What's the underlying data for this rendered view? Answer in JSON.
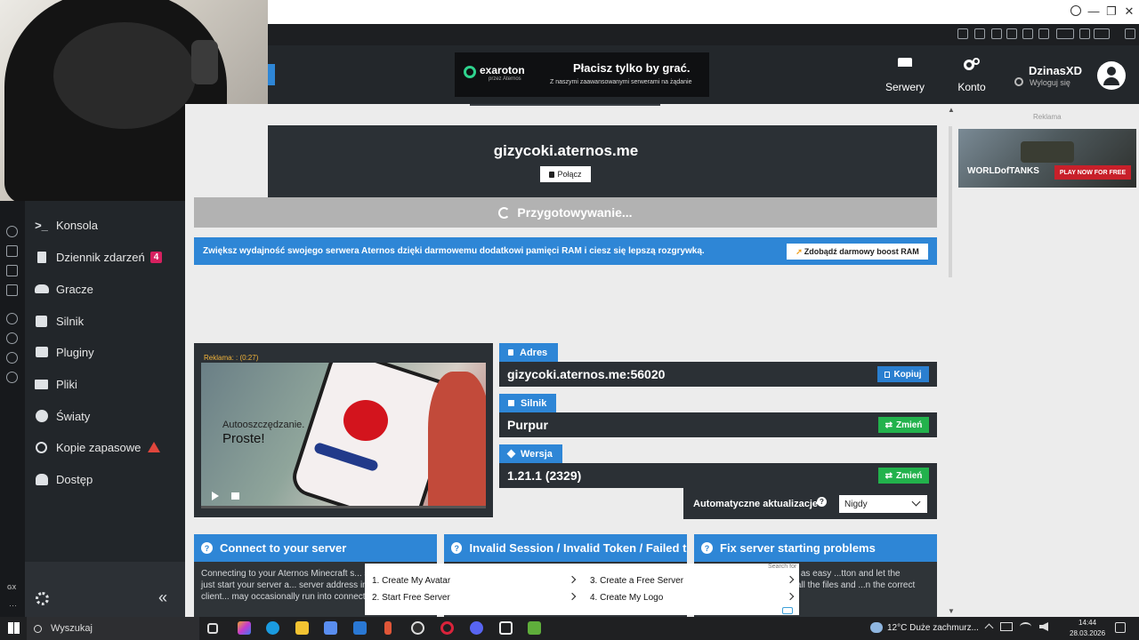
{
  "window": {
    "minimize": "—",
    "maximize": "❐",
    "close": "✕"
  },
  "header": {
    "ad_brand": "exaroton",
    "ad_brand_sub": "przez Aternos",
    "ad_title": "Płacisz tylko by grać.",
    "ad_subtitle": "Z naszymi zaawansowanymi serwerami na żądanie",
    "servers_label": "Serwery",
    "account_label": "Konto",
    "username": "DzinasXD",
    "logout": "Wyloguj się"
  },
  "server": {
    "hostname": "gizycoki.aternos.me",
    "connect_label": "Połącz",
    "status": "Przygotowywanie..."
  },
  "promo": {
    "text": "Zwiększ wydajność swojego serwera Aternos dzięki darmowemu dodatkowi pamięci RAM i ciesz się lepszą rozgrywką.",
    "button": "Zdobądź darmowy boost RAM"
  },
  "video_ad": {
    "timer": "Reklama: : (0:27)",
    "caption_line1": "Autooszczędzanie.",
    "caption_line2": "Proste!"
  },
  "info": {
    "address_label": "Adres",
    "address_value": "gizycoki.aternos.me:56020",
    "copy_label": "Kopiuj",
    "engine_label": "Silnik",
    "engine_value": "Purpur",
    "change_label": "Zmień",
    "version_label": "Wersja",
    "version_value": "1.21.1 (2329)",
    "change_label2": "Zmień",
    "autoupdate_label": "Automatyczne aktualizacje",
    "autoupdate_value": "Nigdy"
  },
  "sidebar": {
    "items": [
      {
        "label": "Konsola",
        "icon": "terminal-icon"
      },
      {
        "label": "Dziennik zdarzeń",
        "icon": "document-icon",
        "badge": "4"
      },
      {
        "label": "Gracze",
        "icon": "users-icon"
      },
      {
        "label": "Silnik",
        "icon": "puzzle-icon"
      },
      {
        "label": "Pluginy",
        "icon": "plugin-icon"
      },
      {
        "label": "Pliki",
        "icon": "folder-icon"
      },
      {
        "label": "Światy",
        "icon": "globe-icon"
      },
      {
        "label": "Kopie zapasowe",
        "icon": "history-icon"
      },
      {
        "label": "Dostęp",
        "icon": "user-lock-icon"
      }
    ]
  },
  "right_ad": {
    "label": "Reklama",
    "game": "WORLDofTANKS",
    "cta": "PLAY NOW FOR FREE"
  },
  "cards": [
    {
      "title": "Connect to your server",
      "body": "Connecting to your Aternos Minecraft s... simple process: just start your server a... server address in your Minecraft client... may occasionally run into connection is..."
    },
    {
      "title": "Invalid Session / Invalid Token / Failed t...",
      "body": ""
    },
    {
      "title": "Fix server starting problems",
      "body": "...Aternos is usually just as easy ...tton and let the Aternos ...rk of loading all the files and ...n the correct configuration. But"
    }
  ],
  "adpopup": {
    "search_for": "Search for",
    "items": [
      "1.  Create My Avatar",
      "2.  Start Free Server",
      "3.  Create a Free Server",
      "4.  Create My Logo"
    ]
  },
  "taskbar": {
    "search": "Wyszukaj",
    "weather": "12°C  Duże zachmurz...",
    "time": "14:44",
    "date": "28.03.2026"
  },
  "colors": {
    "accent": "#2e86d6",
    "success": "#22b24c",
    "sidebar": "#22262a",
    "header": "#23272b"
  }
}
